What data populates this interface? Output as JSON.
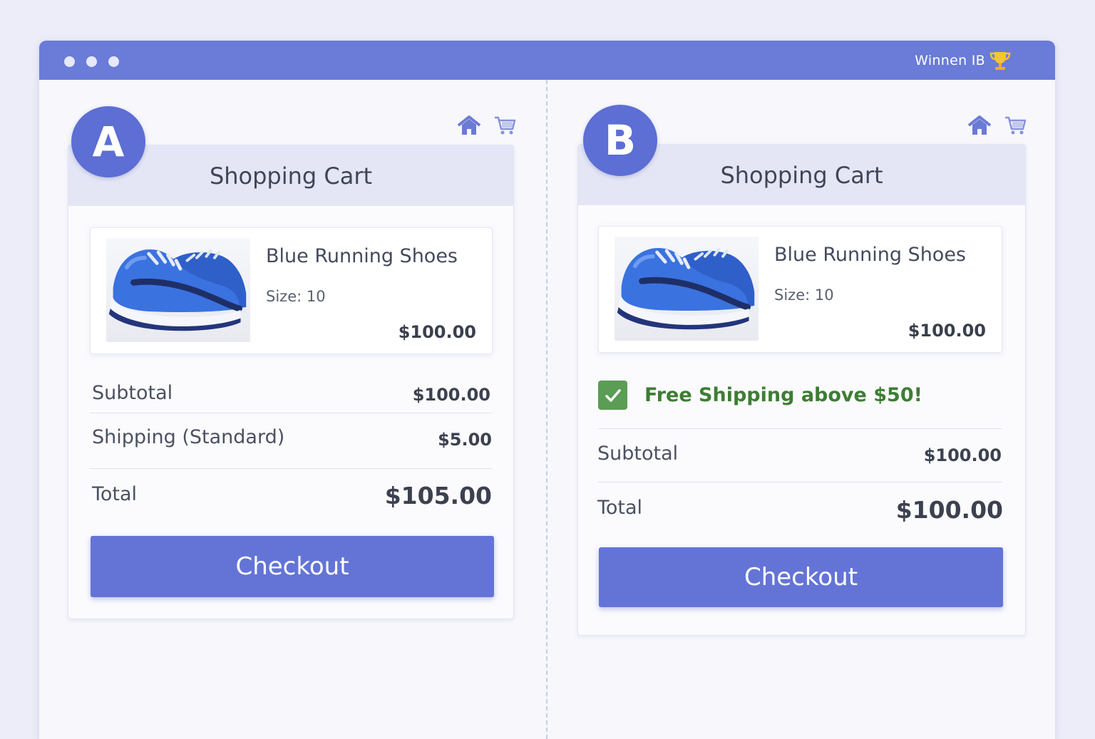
{
  "window": {
    "brand": "Winnen IB",
    "brand_icon": "trophy-icon"
  },
  "colors": {
    "accent": "#6a7bd8",
    "button": "#6474d6",
    "promo_green": "#3e7d34",
    "check_green": "#5b9d55"
  },
  "variant_a": {
    "badge": "A",
    "title": "Shopping Cart",
    "icons": [
      "home-icon",
      "cart-icon"
    ],
    "product": {
      "name": "Blue Running Shoes",
      "size": "Size: 10",
      "price": "$100.00",
      "image": "blue-running-shoes"
    },
    "summary": {
      "subtotal_label": "Subtotal",
      "subtotal_value": "$100.00",
      "shipping_label": "Shipping (Standard)",
      "shipping_value": "$5.00",
      "total_label": "Total",
      "total_value": "$105.00"
    },
    "checkout_label": "Checkout"
  },
  "variant_b": {
    "badge": "B",
    "title": "Shopping Cart",
    "icons": [
      "home-icon",
      "cart-icon"
    ],
    "product": {
      "name": "Blue Running Shoes",
      "size": "Size: 10",
      "price": "$100.00",
      "image": "blue-running-shoes"
    },
    "promo": {
      "text": "Free Shipping above $50!",
      "icon": "checkmark-icon"
    },
    "summary": {
      "subtotal_label": "Subtotal",
      "subtotal_value": "$100.00",
      "total_label": "Total",
      "total_value": "$100.00"
    },
    "checkout_label": "Checkout"
  }
}
